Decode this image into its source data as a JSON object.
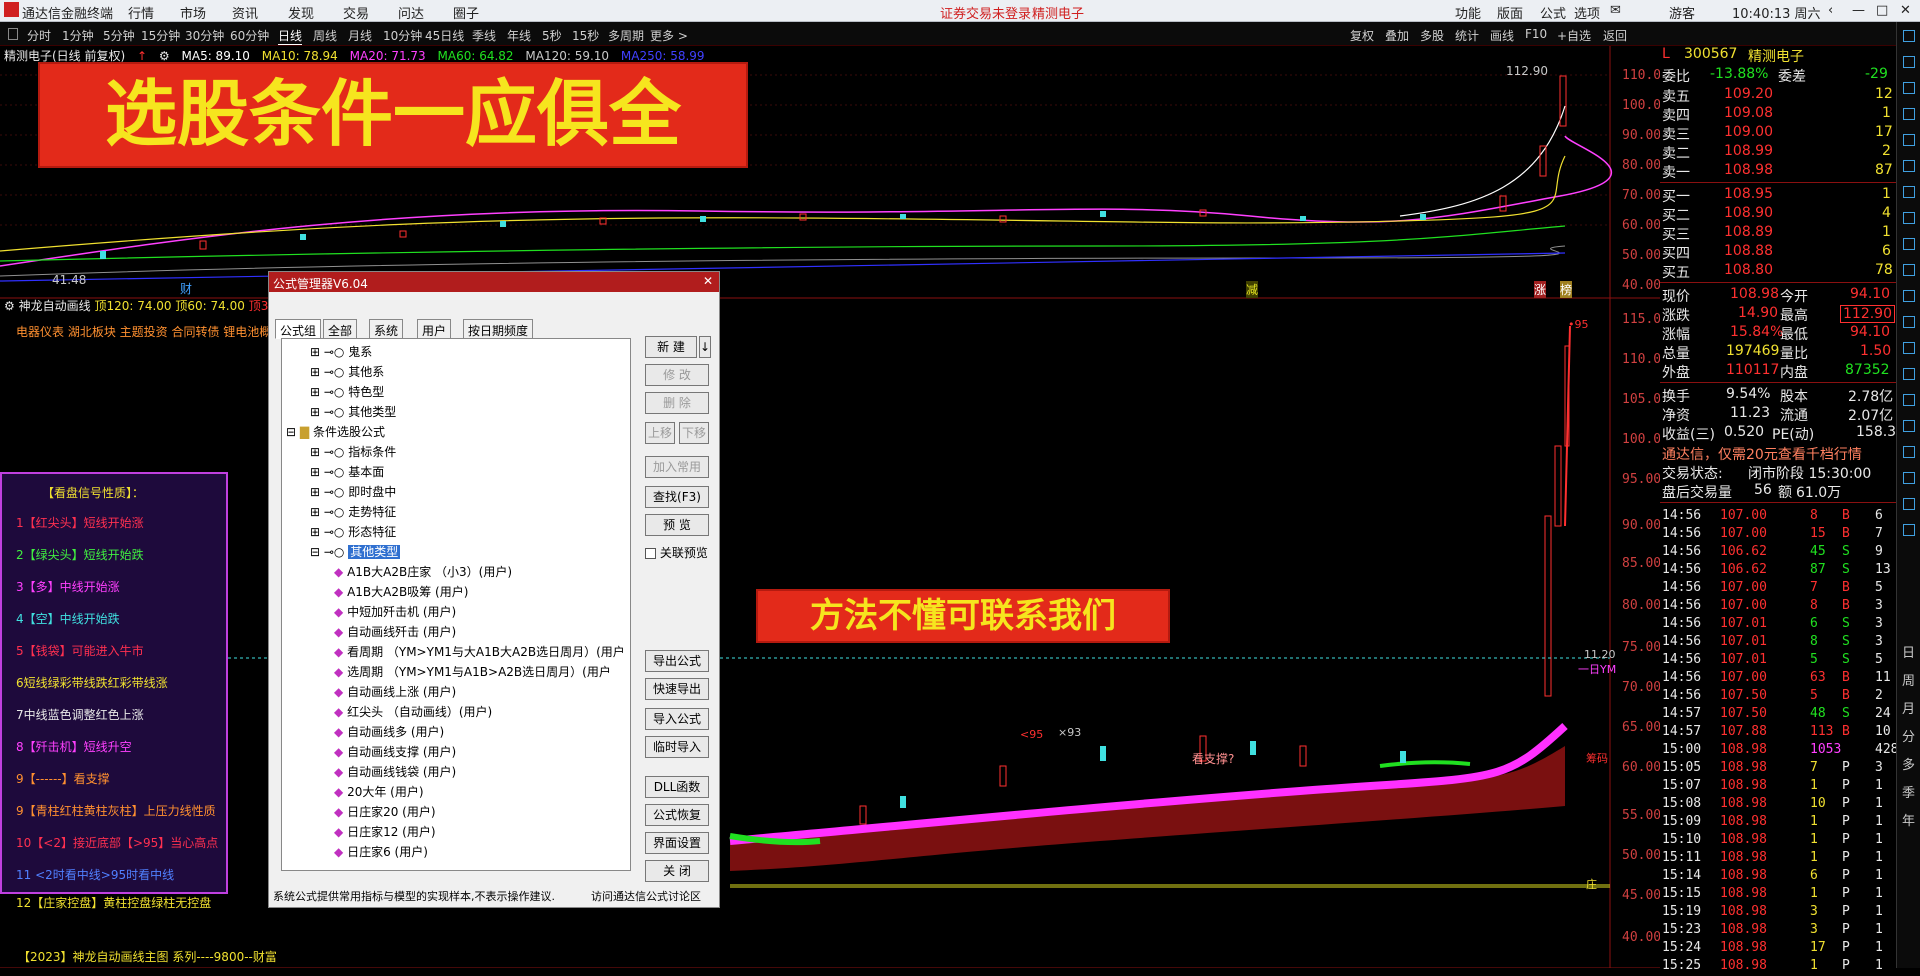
{
  "app": {
    "name": "通达信金融终端",
    "menu": [
      "行情",
      "市场",
      "资讯",
      "发现",
      "交易",
      "问达",
      "圈子"
    ],
    "notice": "证券交易未登录",
    "stock_title": "精测电子",
    "right_menu": [
      "功能",
      "版面",
      "公式",
      "选项"
    ],
    "user": "游客",
    "clock": "10:40:13 周六"
  },
  "periods": {
    "items": [
      "分时",
      "1分钟",
      "5分钟",
      "15分钟",
      "30分钟",
      "60分钟",
      "日线",
      "周线",
      "月线",
      "10分钟",
      "45日线",
      "季线",
      "年线",
      "5秒",
      "15秒",
      "多周期",
      "更多 >"
    ],
    "active": "日线",
    "right": [
      "复权",
      "叠加",
      "多股",
      "统计",
      "画线",
      "F10",
      "+自选",
      "返回"
    ]
  },
  "main_chart": {
    "stock_label": "精测电子(日线 前复权)",
    "ma": [
      {
        "name": "MA5: 89.10",
        "color": "#ffffff"
      },
      {
        "name": "MA10: 78.94",
        "color": "#f0e030"
      },
      {
        "name": "MA20: 71.73",
        "color": "#ff40ff"
      },
      {
        "name": "MA60: 64.82",
        "color": "#20e020"
      },
      {
        "name": "MA120: 59.10",
        "color": "#c8c8c8"
      },
      {
        "name": "MA250: 58.99",
        "color": "#4040ff"
      }
    ],
    "axis": [
      "110.00",
      "100.00",
      "90.00",
      "80.00",
      "70.00",
      "60.00",
      "50.00",
      "40.00"
    ],
    "high_mark": "112.90",
    "low_mark": "41.48",
    "markers": [
      "财",
      "减",
      "涨",
      "榜"
    ]
  },
  "banner1": "选股条件一应俱全",
  "banner2": "方法不懂可联系我们",
  "sub_chart": {
    "label": "神龙自动画线",
    "v1": "顶120: 74.00",
    "v2": "顶60: 74.00",
    "v3": "顶30",
    "concepts": "电器仪表 湖北板块 主题投资 合同转债 锂电池概",
    "axis": [
      "115.00",
      "110.00",
      "105.00",
      "100.00",
      "95.00",
      "90.00",
      "85.00",
      "80.00",
      "75.00",
      "70.00",
      "65.00",
      "60.00",
      "55.00",
      "50.00",
      "45.00",
      "40.00"
    ],
    "notes": [
      "•95",
      "×93",
      "<95",
      "看支撑?",
      "筹码",
      "一日YM",
      "庄",
      "11.20"
    ]
  },
  "legend": {
    "title": "【看盘信号性质】：",
    "items": [
      {
        "t": "1【红尖头】短线开始涨",
        "c": "#ff3050"
      },
      {
        "t": "2【绿尖头】短线开始跌",
        "c": "#40f040"
      },
      {
        "t": "3【多】中线开始涨",
        "c": "#ff40ff"
      },
      {
        "t": "4【空】中线开始跌",
        "c": "#40e0e0"
      },
      {
        "t": "5【钱袋】可能进入牛市",
        "c": "#ff3050"
      },
      {
        "t": "6短线绿彩带线跌红彩带线涨",
        "c": "#f0e030"
      },
      {
        "t": "7中线蓝色调整红色上涨",
        "c": "#e8e8e8"
      },
      {
        "t": "8【歼击机】短线升空",
        "c": "#ff40ff"
      },
      {
        "t": "9【------】看支撑",
        "c": "#ff9030"
      },
      {
        "t": "9【青柱红柱黄柱灰柱】上压力线性质",
        "c": "#ff9030"
      },
      {
        "t": "10【<2】接近底部【>95】当心高点",
        "c": "#ff3050"
      },
      {
        "t": "11 <2时看中线>95时看中线",
        "c": "#5080ff"
      },
      {
        "t": "12【庄家控盘】黄柱控盘绿柱无控盘",
        "c": "#f0e030"
      }
    ]
  },
  "footer_label": "【2023】神龙自动画线主图 系列----9800--财富",
  "dialog": {
    "title": "公式管理器V6.04",
    "tabs": [
      "公式组",
      "全部",
      "系统",
      "用户",
      "按日期频度"
    ],
    "tree": [
      "鬼系",
      "其他系",
      "特色型",
      "其他类型",
      "条件选股公式",
      "指标条件",
      "基本面",
      "即时盘中",
      "走势特征",
      "形态特征",
      "其他类型",
      "A1B大A2B庄家 （小3）(用户)",
      "A1B大A2B吸筹 (用户)",
      "中短加歼击机 (用户)",
      "自动画线歼击 (用户)",
      "看周期 （YM>YM1与大A1B大A2B选日周月）(用户",
      "选周期 （YM>YM1与A1B>A2B选日周月）(用户",
      "自动画线上涨 (用户)",
      "红尖头 （自动画线）(用户)",
      "自动画线多 (用户)",
      "自动画线支撑 (用户)",
      "自动画线钱袋 (用户)",
      "20大年 (用户)",
      "日庄家20 (用户)",
      "日庄家12 (用户)",
      "日庄家6 (用户)"
    ],
    "buttons": [
      "新 建",
      "修 改",
      "删 除",
      "上移",
      "下移",
      "加入常用",
      "查找(F3)",
      "预 览",
      "导出公式",
      "快速导出",
      "导入公式",
      "临时导入",
      "DLL函数",
      "公式恢复",
      "界面设置",
      "关 闭"
    ],
    "checkbox": "关联预览",
    "status": "系统公式提供常用指标与模型的实现样本,不表示操作建议.",
    "link": "访问通达信公式讨论区"
  },
  "quote": {
    "code": "300567",
    "name": "精测电子",
    "wb": "委比",
    "wb_v": "-13.88%",
    "wc": "委差",
    "wc_v": "-29",
    "asks": [
      {
        "n": "卖五",
        "p": "109.20",
        "v": "12"
      },
      {
        "n": "卖四",
        "p": "109.08",
        "v": "1"
      },
      {
        "n": "卖三",
        "p": "109.00",
        "v": "17"
      },
      {
        "n": "卖二",
        "p": "108.99",
        "v": "2"
      },
      {
        "n": "卖一",
        "p": "108.98",
        "v": "87"
      }
    ],
    "bids": [
      {
        "n": "买一",
        "p": "108.95",
        "v": "1"
      },
      {
        "n": "买二",
        "p": "108.90",
        "v": "4"
      },
      {
        "n": "买三",
        "p": "108.89",
        "v": "1"
      },
      {
        "n": "买四",
        "p": "108.88",
        "v": "6"
      },
      {
        "n": "买五",
        "p": "108.80",
        "v": "78"
      }
    ],
    "stats": [
      [
        "现价",
        "108.98",
        "今开",
        "94.10"
      ],
      [
        "涨跌",
        "14.90",
        "最高",
        "112.90"
      ],
      [
        "涨幅",
        "15.84%",
        "最低",
        "94.10"
      ],
      [
        "总量",
        "197469",
        "量比",
        "1.50"
      ],
      [
        "外盘",
        "110117",
        "内盘",
        "87352"
      ],
      [
        "换手",
        "9.54%",
        "股本",
        "2.78亿"
      ],
      [
        "净资",
        "11.23",
        "流通",
        "2.07亿"
      ],
      [
        "收益(三)",
        "0.520",
        "PE(动)",
        "158.3"
      ]
    ],
    "ad": "通达信，仅需20元查看千档行情",
    "state_l": "交易状态:",
    "state_v": "闭市阶段 15:30:00",
    "after_l": "盘后交易量",
    "after_v": "56",
    "amt_l": "额",
    "amt_v": "61.0万"
  },
  "ticks": [
    [
      "14:56",
      "107.00",
      "8",
      "B",
      "6"
    ],
    [
      "14:56",
      "107.00",
      "15",
      "B",
      "7"
    ],
    [
      "14:56",
      "106.62",
      "45",
      "S",
      "9"
    ],
    [
      "14:56",
      "106.62",
      "87",
      "S",
      "13"
    ],
    [
      "14:56",
      "107.00",
      "7",
      "B",
      "5"
    ],
    [
      "14:56",
      "107.00",
      "8",
      "B",
      "3"
    ],
    [
      "14:56",
      "107.01",
      "6",
      "S",
      "3"
    ],
    [
      "14:56",
      "107.01",
      "8",
      "S",
      "3"
    ],
    [
      "14:56",
      "107.01",
      "5",
      "S",
      "5"
    ],
    [
      "14:56",
      "107.00",
      "63",
      "B",
      "11"
    ],
    [
      "14:56",
      "107.50",
      "5",
      "B",
      "2"
    ],
    [
      "14:57",
      "107.50",
      "48",
      "S",
      "24"
    ],
    [
      "14:57",
      "107.88",
      "113",
      "B",
      "10"
    ],
    [
      "15:00",
      "108.98",
      "1053",
      "",
      "428"
    ],
    [
      "15:05",
      "108.98",
      "7",
      "P",
      "3"
    ],
    [
      "15:07",
      "108.98",
      "1",
      "P",
      "1"
    ],
    [
      "15:08",
      "108.98",
      "10",
      "P",
      "1"
    ],
    [
      "15:09",
      "108.98",
      "1",
      "P",
      "1"
    ],
    [
      "15:10",
      "108.98",
      "1",
      "P",
      "1"
    ],
    [
      "15:11",
      "108.98",
      "1",
      "P",
      "1"
    ],
    [
      "15:14",
      "108.98",
      "6",
      "P",
      "1"
    ],
    [
      "15:15",
      "108.98",
      "1",
      "P",
      "1"
    ],
    [
      "15:19",
      "108.98",
      "3",
      "P",
      "1"
    ],
    [
      "15:23",
      "108.98",
      "3",
      "P",
      "1"
    ],
    [
      "15:24",
      "108.98",
      "17",
      "P",
      "1"
    ],
    [
      "15:25",
      "108.98",
      "1",
      "P",
      "1"
    ]
  ],
  "side_tools": [
    "日",
    "周",
    "月",
    "分",
    "多",
    "季",
    "年"
  ],
  "colors": {
    "up": "#ff3030",
    "down": "#40e0e0",
    "banner_bg": "#e32a1a",
    "banner_text": "#f6e51e"
  }
}
